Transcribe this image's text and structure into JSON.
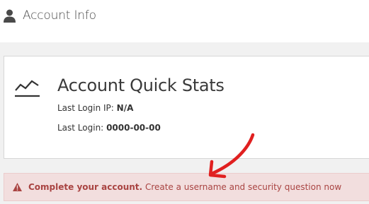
{
  "header": {
    "icon": "user-icon",
    "title": "Account Info"
  },
  "quick_stats": {
    "icon": "line-chart-icon",
    "title": "Account Quick Stats",
    "last_login_ip_label": "Last Login IP:",
    "last_login_ip_value": "N/A",
    "last_login_label": "Last Login:",
    "last_login_value": "0000-00-00"
  },
  "alert": {
    "icon": "warning-icon",
    "bold_text": "Complete your account.",
    "link_text": "Create a username and security question now",
    "color": "#a94442",
    "background": "#f2dede"
  },
  "annotation": {
    "icon": "red-arrow-annotation",
    "color": "#e02020"
  }
}
